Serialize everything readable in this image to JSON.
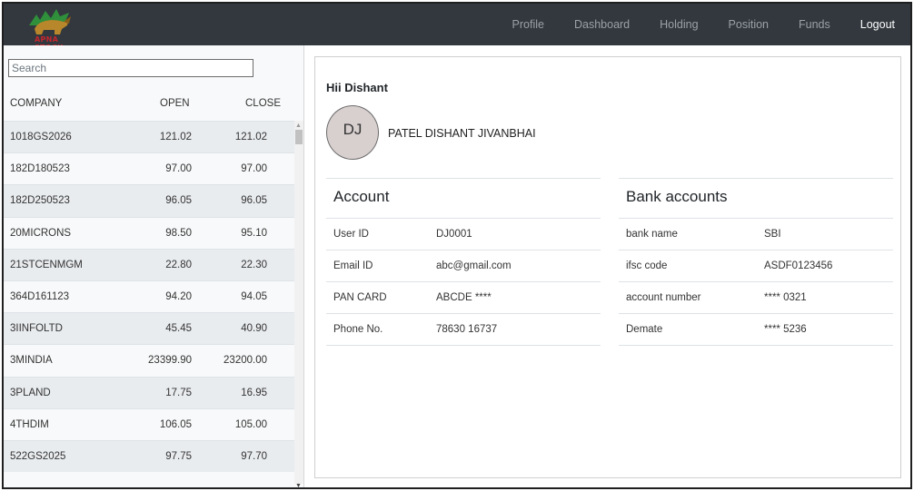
{
  "navbar": {
    "logo_text": "APNA STOCK",
    "links": [
      "Profile",
      "Dashboard",
      "Holding",
      "Position",
      "Funds",
      "Logout"
    ]
  },
  "watchlist": {
    "search_placeholder": "Search",
    "headers": {
      "company": "COMPANY",
      "open": "OPEN",
      "close": "CLOSE"
    },
    "rows": [
      {
        "company": "1018GS2026",
        "open": "121.02",
        "close": "121.02"
      },
      {
        "company": "182D180523",
        "open": "97.00",
        "close": "97.00"
      },
      {
        "company": "182D250523",
        "open": "96.05",
        "close": "96.05"
      },
      {
        "company": "20MICRONS",
        "open": "98.50",
        "close": "95.10"
      },
      {
        "company": "21STCENMGM",
        "open": "22.80",
        "close": "22.30"
      },
      {
        "company": "364D161123",
        "open": "94.20",
        "close": "94.05"
      },
      {
        "company": "3IINFOLTD",
        "open": "45.45",
        "close": "40.90"
      },
      {
        "company": "3MINDIA",
        "open": "23399.90",
        "close": "23200.00"
      },
      {
        "company": "3PLAND",
        "open": "17.75",
        "close": "16.95"
      },
      {
        "company": "4THDIM",
        "open": "106.05",
        "close": "105.00"
      },
      {
        "company": "522GS2025",
        "open": "97.75",
        "close": "97.70"
      }
    ]
  },
  "profile": {
    "greeting": "Hii Dishant",
    "initials": "DJ",
    "full_name": "PATEL DISHANT JIVANBHAI",
    "account": {
      "title": "Account",
      "fields": [
        {
          "label": "User ID",
          "value": "DJ0001"
        },
        {
          "label": "Email ID",
          "value": "abc@gmail.com"
        },
        {
          "label": "PAN CARD",
          "value": "ABCDE ****"
        },
        {
          "label": "Phone No.",
          "value": "78630 16737"
        }
      ]
    },
    "bank": {
      "title": "Bank accounts",
      "fields": [
        {
          "label": "bank name",
          "value": "SBI"
        },
        {
          "label": "ifsc code",
          "value": "ASDF0123456"
        },
        {
          "label": "account number",
          "value": "**** 0321"
        },
        {
          "label": "Demate",
          "value": "**** 5236"
        }
      ]
    }
  },
  "colors": {
    "navbar_bg": "#32383e",
    "nav_link": "#9aa0a6",
    "nav_active": "#ffffff",
    "logo_red": "#c6262e",
    "logo_green": "#2f8f3a",
    "logo_gold": "#b8862b",
    "avatar_bg": "#d8cfcf"
  }
}
